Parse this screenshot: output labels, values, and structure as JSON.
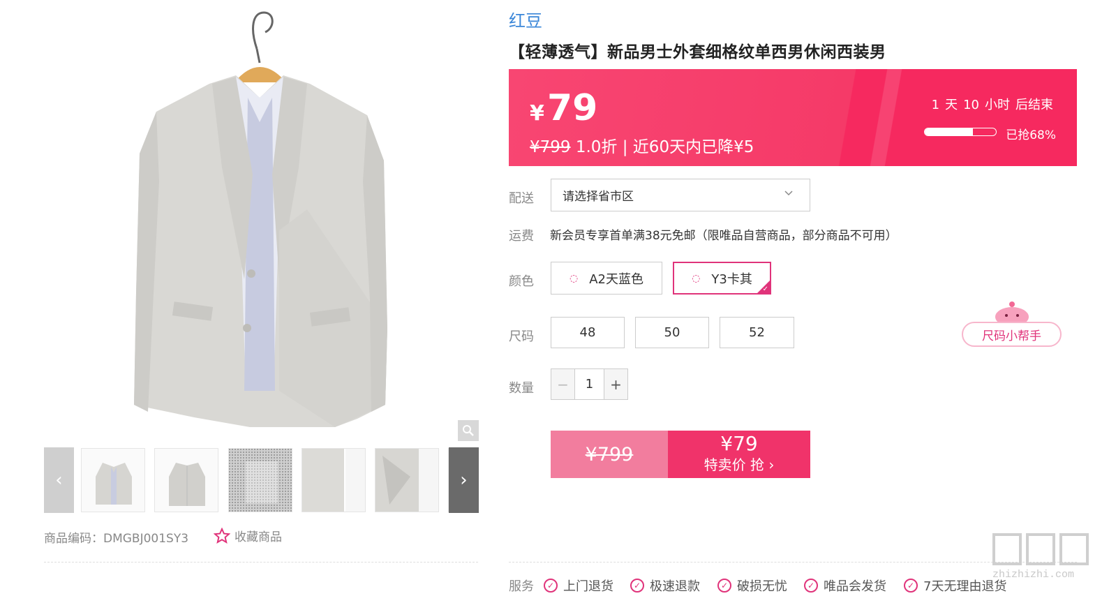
{
  "gallery": {
    "prev_arrow": "‹",
    "next_arrow": "›",
    "thumbnails": [
      "front",
      "back",
      "fabric",
      "detail",
      "lapel",
      "pocket"
    ]
  },
  "meta": {
    "sku_text": "商品编码：DMGBJ001SY3",
    "favorite_label": "收藏商品"
  },
  "product": {
    "brand": "红豆",
    "title": "【轻薄透气】新品男士外套细格纹单西男休闲西装男"
  },
  "price_banner": {
    "currency": "¥",
    "price": "79",
    "original_price": "¥799",
    "discount_info": " 1.0折 | 近60天内已降¥5",
    "countdown": {
      "days": "1",
      "day_unit": "天",
      "hours": "10",
      "hour_unit": "小时",
      "suffix": "后结束"
    },
    "sold_text": "已抢68%",
    "sold_fraction": 0.68
  },
  "delivery": {
    "label": "配送",
    "select_value": "请选择省市区",
    "fee_label": "运费",
    "fee_text": "新会员专享首单满38元免邮（限唯品自营商品，部分商品不可用）"
  },
  "color": {
    "label": "颜色",
    "options": [
      "A2天蓝色",
      "Y3卡其"
    ],
    "selected": "Y3卡其"
  },
  "size": {
    "label": "尺码",
    "options": [
      "48",
      "50",
      "52"
    ],
    "helper_label": "尺码小帮手"
  },
  "quantity": {
    "label": "数量",
    "value": "1",
    "minus": "−",
    "plus": "+"
  },
  "buy": {
    "original_price": "¥799",
    "sale_price": "¥79",
    "sale_label": "特卖价 抢 ›"
  },
  "services": {
    "label": "服务",
    "items": [
      "上门退货",
      "极速退款",
      "破损无忧",
      "唯品会发货",
      "7天无理由退货"
    ]
  },
  "watermark": {
    "text": "zhizhizhi.com"
  },
  "colors": {
    "accent": "#f0336a",
    "brand_link": "#3a86d8",
    "banner": "#f6295f"
  }
}
